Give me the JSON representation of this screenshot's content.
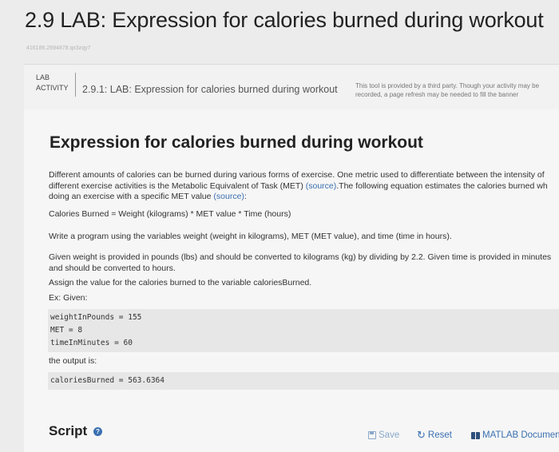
{
  "page": {
    "title": "2.9 LAB: Expression for calories burned during workout",
    "id_text": "416186.2694878.qx3zqy7"
  },
  "lab_banner": {
    "tag_line1": "LAB",
    "tag_line2": "ACTIVITY",
    "name": "2.9.1: LAB: Expression for calories burned during workout",
    "notice_line1": "This tool is provided by a third party. Though your activity may be",
    "notice_line2": "recorded, a page refresh may be needed to fill the banner"
  },
  "content": {
    "heading": "Expression for calories burned during workout",
    "intro": {
      "line1": "Different amounts of calories can be burned during various forms of exercise. One metric used to differentiate between the intensity of",
      "line2_a": "different exercise activities is the Metabolic Equivalent of Task (MET) ",
      "line2_link": "(source)",
      "line2_b": ".The following equation estimates the calories burned wh",
      "line3_a": "doing an exercise with a specific MET value ",
      "line3_link": "(source)",
      "line3_b": ":"
    },
    "equation": "Calories Burned = Weight (kilograms) * MET value * Time (hours)",
    "instruction": "Write a program using the variables weight (weight in kilograms), MET (MET value), and time (time in hours).",
    "given_line1": "Given weight is provided in pounds (lbs) and should be converted to kilograms (kg) by dividing by 2.2. Given time is provided in minutes",
    "given_line2": "and should be converted to hours.",
    "assign": "Assign the value for the calories burned to the variable caloriesBurned.",
    "example_label": "Ex: Given:",
    "code_given": [
      "weightInPounds = 155",
      "MET = 8",
      "timeInMinutes = 60"
    ],
    "output_label": "the output is:",
    "code_output": "caloriesBurned = 563.6364"
  },
  "script": {
    "label": "Script",
    "help": "?"
  },
  "toolbar": {
    "save_label": "Save",
    "reset_label": "Reset",
    "doc_label": "MATLAB Documentation"
  },
  "icons": {
    "help": "help-icon",
    "save": "save-icon",
    "reset": "reset-icon",
    "documentation": "book-icon"
  },
  "colors": {
    "link": "#3a6fb0",
    "save_disabled": "#8aa8c8",
    "background": "#ececec"
  }
}
